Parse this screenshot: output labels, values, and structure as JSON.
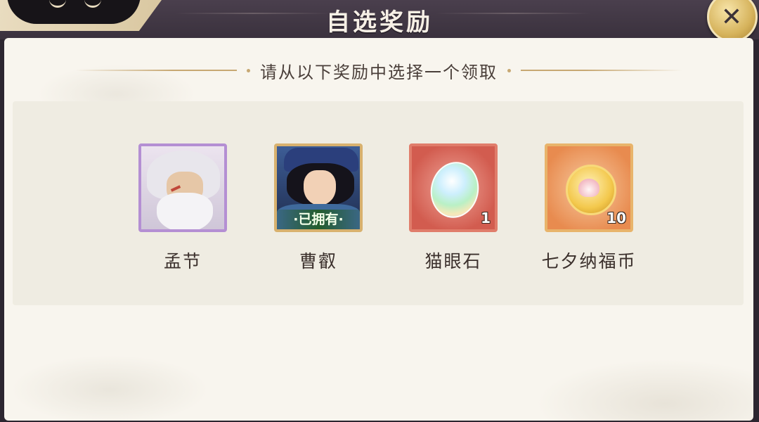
{
  "header": {
    "title": "自选奖励",
    "close_icon": "close-icon"
  },
  "panel": {
    "subtitle": "请从以下奖励中选择一个领取"
  },
  "rewards": [
    {
      "name": "孟节",
      "rarity_color": "#b48fd3",
      "badge": "",
      "count": ""
    },
    {
      "name": "曹叡",
      "rarity_color": "#d8b16e",
      "badge": "·已拥有·",
      "count": ""
    },
    {
      "name": "猫眼石",
      "rarity_color": "#e07d6b",
      "badge": "",
      "count": "1"
    },
    {
      "name": "七夕纳福币",
      "rarity_color": "#e8b46b",
      "badge": "",
      "count": "10"
    }
  ]
}
